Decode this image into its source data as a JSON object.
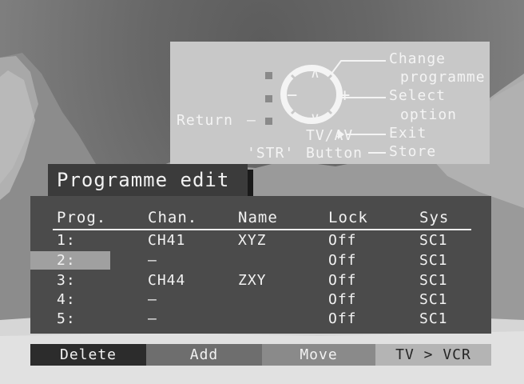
{
  "help": {
    "change_label": "Change",
    "programme_label": "programme",
    "select_label": "Select",
    "option_label": "option",
    "return_label": "Return",
    "tvav_label": "TV/AV",
    "exit_label": "Exit",
    "str_label": "'STR'",
    "button_label": "Button",
    "store_label": "Store",
    "plus_symbol": "+",
    "minus_symbol": "−",
    "up_symbol": "∧",
    "down_symbol": "∨",
    "dash_symbol": "–"
  },
  "title": "Programme edit",
  "table": {
    "headers": [
      "Prog.",
      "Chan.",
      "Name",
      "Lock",
      "Sys"
    ],
    "rows": [
      {
        "prog": "1:",
        "chan": "CH41",
        "name": "XYZ",
        "lock": "Off",
        "sys": "SC1",
        "selected": false
      },
      {
        "prog": "2:",
        "chan": "–",
        "name": "",
        "lock": "Off",
        "sys": "SC1",
        "selected": true
      },
      {
        "prog": "3:",
        "chan": "CH44",
        "name": "ZXY",
        "lock": "Off",
        "sys": "SC1",
        "selected": false
      },
      {
        "prog": "4:",
        "chan": "–",
        "name": "",
        "lock": "Off",
        "sys": "SC1",
        "selected": false
      },
      {
        "prog": "5:",
        "chan": "–",
        "name": "",
        "lock": "Off",
        "sys": "SC1",
        "selected": false
      }
    ]
  },
  "function_bar": {
    "delete_label": "Delete",
    "add_label": "Add",
    "move_label": "Move",
    "tv_vcr_label": "TV > VCR"
  },
  "colors": {
    "delete_tab": "#2c2c2c",
    "add_tab": "#6e6e6e",
    "move_tab": "#8a8a8a",
    "tv_vcr_tab": "#b4b4b4",
    "panel": "#4b4b4b",
    "help_panel": "#c8c8c8",
    "highlight": "#a0a0a0"
  }
}
